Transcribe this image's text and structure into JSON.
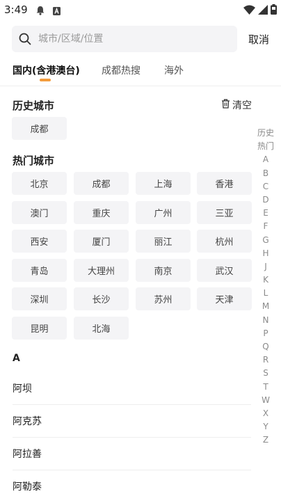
{
  "status_bar": {
    "time": "3:49",
    "icons": [
      "notification-bell-icon",
      "sim-a-icon",
      "wifi-icon",
      "signal-icon",
      "battery-icon"
    ]
  },
  "search": {
    "placeholder": "城市/区域/位置",
    "cancel_label": "取消"
  },
  "tabs": [
    {
      "label": "国内(含港澳台)",
      "active": true
    },
    {
      "label": "成都热搜",
      "active": false
    },
    {
      "label": "海外",
      "active": false
    }
  ],
  "history": {
    "title": "历史城市",
    "clear_label": "清空",
    "cities": [
      "成都"
    ]
  },
  "hot": {
    "title": "热门城市",
    "cities": [
      "北京",
      "成都",
      "上海",
      "香港",
      "澳门",
      "重庆",
      "广州",
      "三亚",
      "西安",
      "厦门",
      "丽江",
      "杭州",
      "青岛",
      "大理州",
      "南京",
      "武汉",
      "深圳",
      "长沙",
      "苏州",
      "天津",
      "昆明",
      "北海"
    ]
  },
  "index_bar": [
    "历史",
    "热门",
    "A",
    "B",
    "C",
    "D",
    "E",
    "F",
    "G",
    "H",
    "J",
    "K",
    "L",
    "M",
    "N",
    "P",
    "Q",
    "R",
    "S",
    "T",
    "W",
    "X",
    "Y",
    "Z"
  ],
  "city_list": {
    "letter": "A",
    "cities": [
      "阿坝",
      "阿克苏",
      "阿拉善",
      "阿勒泰"
    ]
  },
  "colors": {
    "accent": "#f39c3c",
    "chip_bg": "#f4f4f6"
  }
}
